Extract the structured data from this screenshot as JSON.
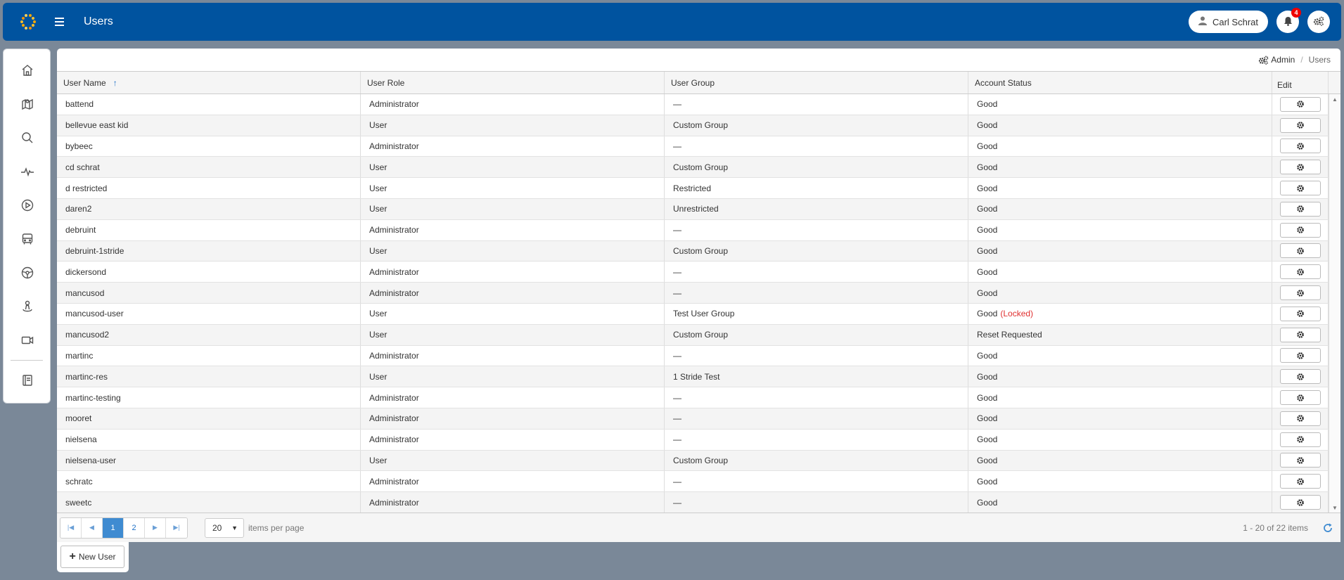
{
  "header": {
    "title": "Users",
    "user_name": "Carl Schrat",
    "notification_count": "4"
  },
  "breadcrumb": {
    "admin": "Admin",
    "current": "Users"
  },
  "table": {
    "columns": {
      "user_name": "User Name",
      "user_role": "User Role",
      "user_group": "User Group",
      "account_status": "Account Status",
      "edit": "Edit"
    },
    "sort_indicator": "↑",
    "rows": [
      {
        "name": "battend",
        "role": "Administrator",
        "group": "—",
        "status": "Good",
        "locked": ""
      },
      {
        "name": "bellevue east kid",
        "role": "User",
        "group": "Custom Group",
        "status": "Good",
        "locked": ""
      },
      {
        "name": "bybeec",
        "role": "Administrator",
        "group": "—",
        "status": "Good",
        "locked": ""
      },
      {
        "name": "cd schrat",
        "role": "User",
        "group": "Custom Group",
        "status": "Good",
        "locked": ""
      },
      {
        "name": "d restricted",
        "role": "User",
        "group": "Restricted",
        "status": "Good",
        "locked": ""
      },
      {
        "name": "daren2",
        "role": "User",
        "group": "Unrestricted",
        "status": "Good",
        "locked": ""
      },
      {
        "name": "debruint",
        "role": "Administrator",
        "group": "—",
        "status": "Good",
        "locked": ""
      },
      {
        "name": "debruint-1stride",
        "role": "User",
        "group": "Custom Group",
        "status": "Good",
        "locked": ""
      },
      {
        "name": "dickersond",
        "role": "Administrator",
        "group": "—",
        "status": "Good",
        "locked": ""
      },
      {
        "name": "mancusod",
        "role": "Administrator",
        "group": "—",
        "status": "Good",
        "locked": ""
      },
      {
        "name": "mancusod-user",
        "role": "User",
        "group": "Test User Group",
        "status": "Good",
        "locked": "(Locked)"
      },
      {
        "name": "mancusod2",
        "role": "User",
        "group": "Custom Group",
        "status": "Reset Requested",
        "locked": ""
      },
      {
        "name": "martinc",
        "role": "Administrator",
        "group": "—",
        "status": "Good",
        "locked": ""
      },
      {
        "name": "martinc-res",
        "role": "User",
        "group": "1 Stride Test",
        "status": "Good",
        "locked": ""
      },
      {
        "name": "martinc-testing",
        "role": "Administrator",
        "group": "—",
        "status": "Good",
        "locked": ""
      },
      {
        "name": "mooret",
        "role": "Administrator",
        "group": "—",
        "status": "Good",
        "locked": ""
      },
      {
        "name": "nielsena",
        "role": "Administrator",
        "group": "—",
        "status": "Good",
        "locked": ""
      },
      {
        "name": "nielsena-user",
        "role": "User",
        "group": "Custom Group",
        "status": "Good",
        "locked": ""
      },
      {
        "name": "schratc",
        "role": "Administrator",
        "group": "—",
        "status": "Good",
        "locked": ""
      },
      {
        "name": "sweetc",
        "role": "Administrator",
        "group": "—",
        "status": "Good",
        "locked": ""
      }
    ]
  },
  "pager": {
    "pages": [
      "1",
      "2"
    ],
    "active_page": "1",
    "page_size": "20",
    "page_size_label": "items per page",
    "info": "1 - 20 of 22 items"
  },
  "actions": {
    "new_user": "New User"
  },
  "sidebar": {
    "icons": [
      "home-icon",
      "map-icon",
      "search-icon",
      "activity-icon",
      "play-icon",
      "bus-icon",
      "steering-wheel-icon",
      "location-person-icon",
      "video-camera-icon",
      "book-icon"
    ]
  },
  "colors": {
    "header_bg": "#00539f",
    "page_bg": "#7a8898",
    "accent": "#3f8bd1",
    "badge": "#ee0000",
    "locked": "#e03030"
  }
}
